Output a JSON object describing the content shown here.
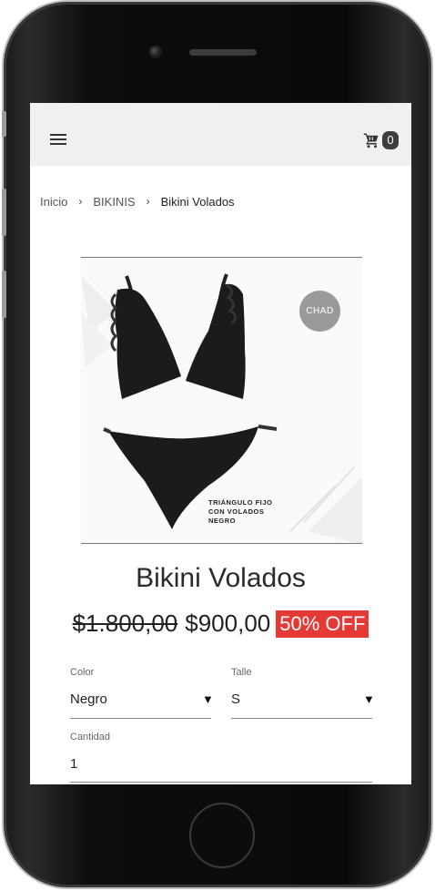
{
  "header": {
    "menu_icon": "hamburger-menu-icon",
    "cart_icon": "shopping-cart-icon",
    "cart_count": "0"
  },
  "breadcrumb": {
    "items": [
      "Inicio",
      "BIKINIS",
      "Bikini Volados"
    ],
    "separator": "›"
  },
  "product": {
    "image": {
      "brand_badge": "CHAD",
      "caption_lines": [
        "TRIÁNGULO FIJO",
        "CON VOLADOS",
        "NEGRO"
      ]
    },
    "title": "Bikini Volados",
    "old_price": "$1.800,00",
    "price": "$900,00",
    "discount_badge": "50% OFF"
  },
  "options": {
    "color": {
      "label": "Color",
      "value": "Negro"
    },
    "size": {
      "label": "Talle",
      "value": "S"
    },
    "quantity": {
      "label": "Cantidad",
      "value": "1"
    }
  },
  "colors": {
    "header_bg": "#eef1ed",
    "discount_bg": "#e53935",
    "cart_badge_bg": "#3d3d3d",
    "text": "#222222"
  }
}
